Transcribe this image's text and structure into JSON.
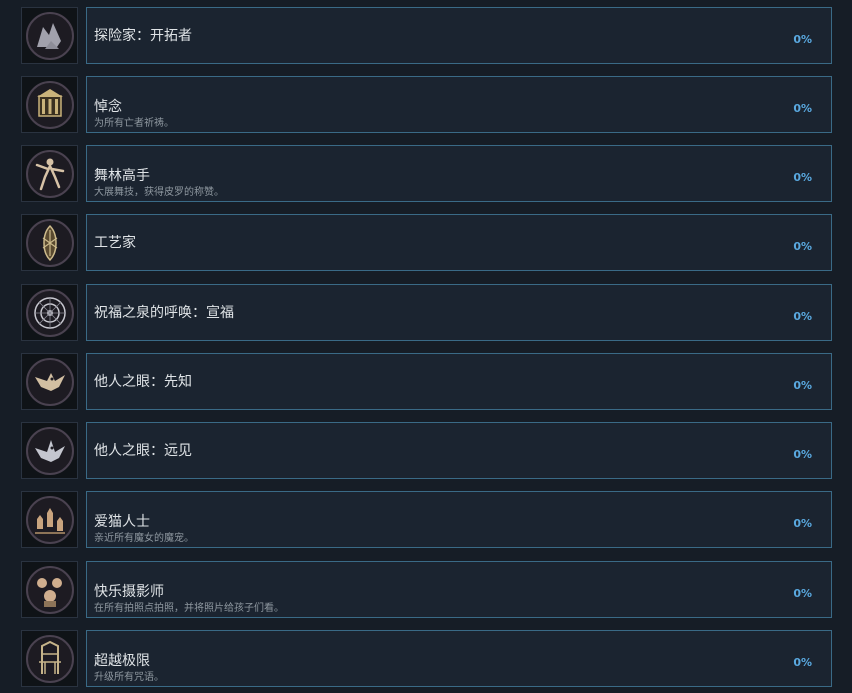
{
  "achievements": [
    {
      "title": "探险家：开拓者",
      "desc": "",
      "percent": "0%",
      "icon": "explorer-icon",
      "accent": "#b9b9c4"
    },
    {
      "title": "悼念",
      "desc": "为所有亡者祈祷。",
      "percent": "0%",
      "icon": "shrine-icon",
      "accent": "#c9b27a"
    },
    {
      "title": "舞林高手",
      "desc": "大展舞技，获得皮罗的称赞。",
      "percent": "0%",
      "icon": "dancer-icon",
      "accent": "#d6c2a6"
    },
    {
      "title": "工艺家",
      "desc": "",
      "percent": "0%",
      "icon": "craftsman-icon",
      "accent": "#cdbb8c"
    },
    {
      "title": "祝福之泉的呼唤：宣福",
      "desc": "",
      "percent": "0%",
      "icon": "blessing-fountain-icon",
      "accent": "#c8c8d0"
    },
    {
      "title": "他人之眼：先知",
      "desc": "",
      "percent": "0%",
      "icon": "raven-prophet-icon",
      "accent": "#d2bfa2"
    },
    {
      "title": "他人之眼：远见",
      "desc": "",
      "percent": "0%",
      "icon": "raven-foresight-icon",
      "accent": "#c4c6cf"
    },
    {
      "title": "爱猫人士",
      "desc": "亲近所有魔女的魔宠。",
      "percent": "0%",
      "icon": "cats-icon",
      "accent": "#c9a47e"
    },
    {
      "title": "快乐摄影师",
      "desc": "在所有拍照点拍照，并将照片给孩子们看。",
      "percent": "0%",
      "icon": "photographer-icon",
      "accent": "#cfae8e"
    },
    {
      "title": "超越极限",
      "desc": "升级所有咒语。",
      "percent": "0%",
      "icon": "throne-icon",
      "accent": "#c6b48a"
    }
  ]
}
